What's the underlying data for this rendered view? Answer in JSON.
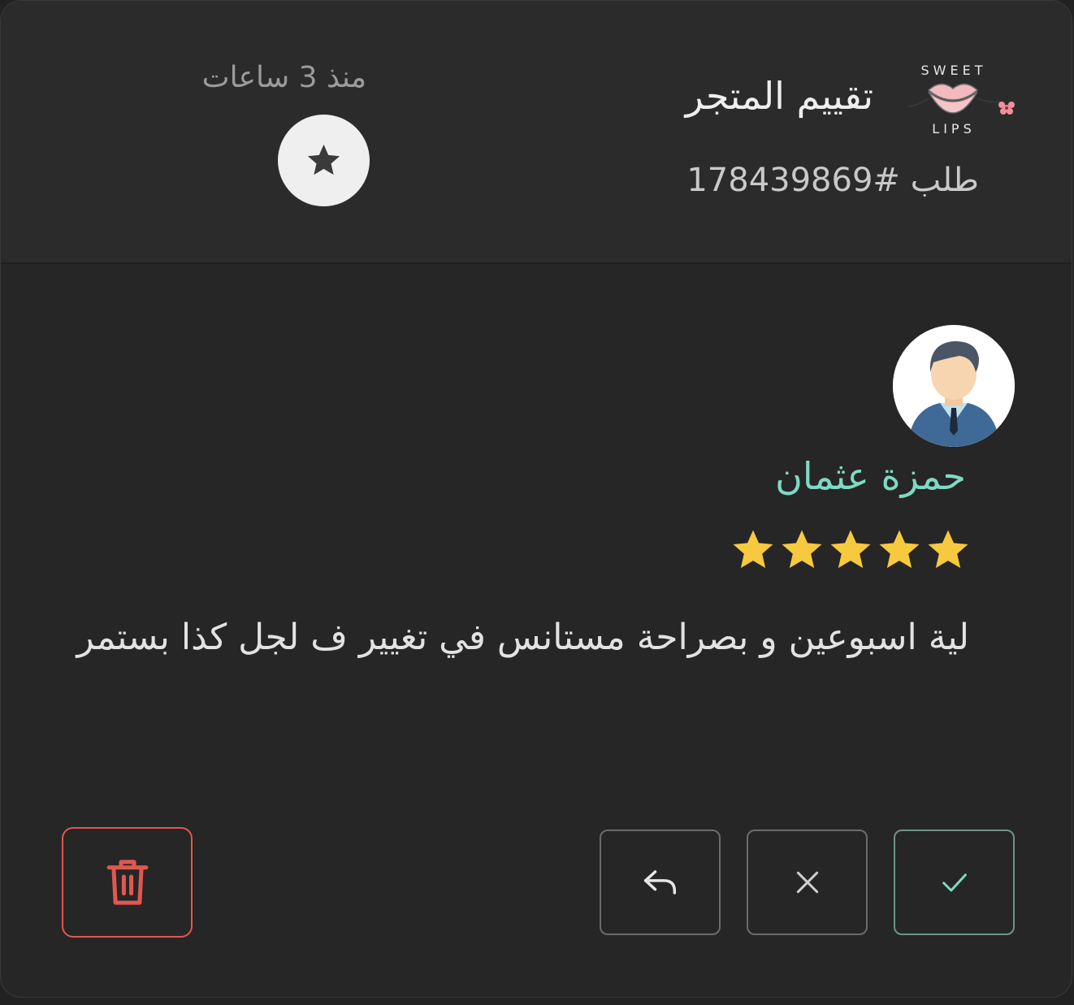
{
  "header": {
    "logo_top": "SWEET",
    "logo_bottom": "LIPS",
    "title": "تقييم المتجر",
    "order": "طلب #178439869",
    "time_ago": "منذ 3 ساعات",
    "badge_icon": "star-icon"
  },
  "review": {
    "reviewer_name": "حمزة عثمان",
    "rating": 5,
    "rating_max": 5,
    "comment": "لية اسبوعين و بصراحة مستانس في تغيير ف لجل كذا بستمر"
  },
  "actions": {
    "approve_icon": "check-icon",
    "reject_icon": "close-icon",
    "reply_icon": "reply-icon",
    "delete_icon": "trash-icon"
  },
  "colors": {
    "background": "#262626",
    "header_background": "#2b2b2b",
    "reviewer_name": "#7fd9c3",
    "star": "#f7c93e",
    "approve": "#7fd9c3",
    "delete": "#e0584f"
  }
}
